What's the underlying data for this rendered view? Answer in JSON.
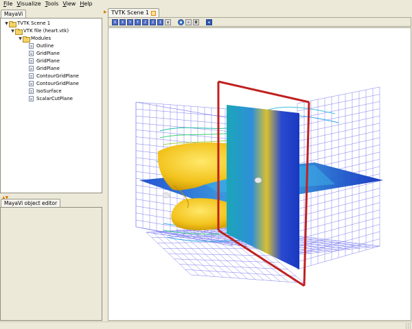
{
  "menubar": {
    "items": [
      {
        "first": "F",
        "rest": "ile"
      },
      {
        "first": "V",
        "rest": "isualize"
      },
      {
        "first": "T",
        "rest": "ools"
      },
      {
        "first": "V",
        "rest": "iew"
      },
      {
        "first": "H",
        "rest": "elp"
      }
    ]
  },
  "left": {
    "tree_tab": "MayaVi",
    "editor_tab": "MayaVi object editor",
    "tree": {
      "scene": "TVTK Scene 1",
      "source": "VTK file (heart.vtk)",
      "modules_label": "Modules",
      "modules": [
        "Outline",
        "GridPlane",
        "GridPlane",
        "GridPlane",
        "ContourGridPlane",
        "ContourGridPlane",
        "IsoSurface",
        "ScalarCutPlane"
      ]
    }
  },
  "scene": {
    "tab_label": "TVTK Scene 1",
    "toolbar_icons": [
      "view-x-icon",
      "view-neg-x-icon",
      "view-y-icon",
      "view-neg-y-icon",
      "view-z-icon",
      "view-neg-z-icon",
      "view-iso-icon",
      "parallel-projection-icon",
      "separator",
      "axes-icon",
      "light-icon",
      "fullscreen-icon",
      "separator",
      "save-icon"
    ],
    "toolbar_glyphs": [
      "X",
      "X",
      "Y",
      "Y",
      "Z",
      "Z",
      "I",
      "▮",
      "",
      "●",
      "✣",
      "◘",
      "",
      "▪"
    ]
  },
  "colors": {
    "iso": "#f2c21b",
    "plane_dark": "#1037c8",
    "plane_mid": "#21a4d6",
    "outline": "#c02020",
    "grid": "#6a6af0"
  }
}
